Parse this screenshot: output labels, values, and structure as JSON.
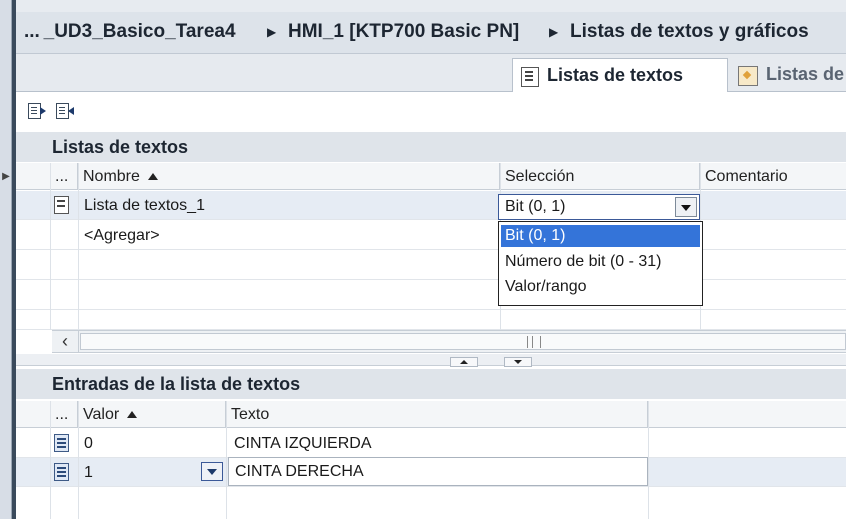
{
  "breadcrumb": {
    "part1": "... _UD3_Basico_Tarea4",
    "part2": "HMI_1 [KTP700 Basic PN]",
    "part3": "Listas de textos y gráficos"
  },
  "tabs": [
    {
      "label": "Listas de textos",
      "active": true
    },
    {
      "label": "Listas de",
      "active": false
    }
  ],
  "text_lists": {
    "title": "Listas de textos",
    "columns": {
      "dots": "...",
      "name": "Nombre",
      "selection": "Selección",
      "comment": "Comentario"
    },
    "rows": [
      {
        "name": "Lista de textos_1",
        "selection": "Bit (0, 1)"
      },
      {
        "name": "<Agregar>"
      }
    ],
    "dropdown_options": [
      "Bit (0, 1)",
      "Número de bit (0 - 31)",
      "Valor/rango"
    ],
    "dropdown_highlighted": "Bit (0, 1)"
  },
  "entries": {
    "title": "Entradas de la lista de textos",
    "columns": {
      "dots": "...",
      "value": "Valor",
      "text": "Texto"
    },
    "rows": [
      {
        "value": "0",
        "text": "CINTA IZQUIERDA"
      },
      {
        "value": "1",
        "text": "CINTA DERECHA"
      }
    ]
  },
  "colors": {
    "accent": "#3474d9",
    "header_bg": "#dfe4ea"
  }
}
